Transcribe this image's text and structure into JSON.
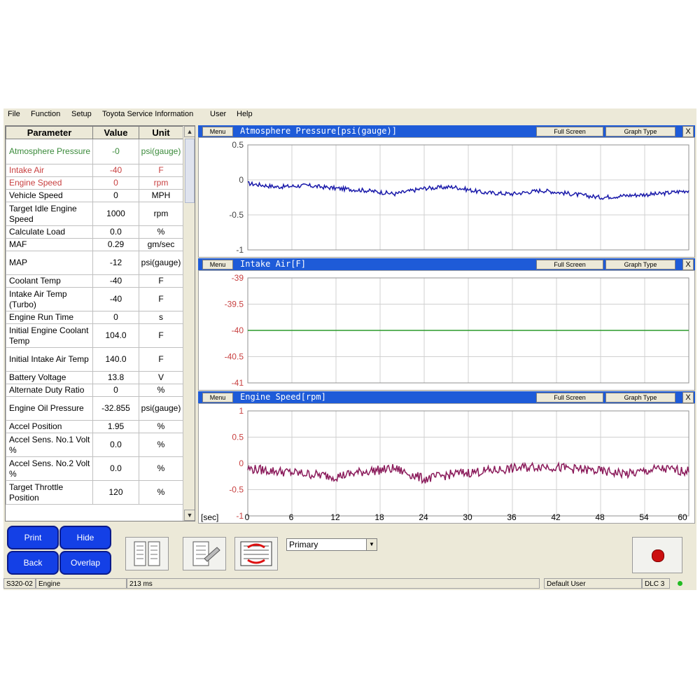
{
  "menu": [
    "File",
    "Function",
    "Setup",
    "Toyota Service Information",
    "User",
    "Help"
  ],
  "table": {
    "headers": [
      "Parameter",
      "Value",
      "Unit"
    ],
    "rows": [
      {
        "p": "Atmosphere Pressure",
        "v": "-0",
        "u": "psi(gauge)",
        "color": "#3a8a3a"
      },
      {
        "p": "Intake Air",
        "v": "-40",
        "u": "F",
        "color": "#c84040"
      },
      {
        "p": "Engine Speed",
        "v": "0",
        "u": "rpm",
        "color": "#c84040"
      },
      {
        "p": "Vehicle Speed",
        "v": "0",
        "u": "MPH",
        "color": "#000000"
      },
      {
        "p": "Target Idle Engine Speed",
        "v": "1000",
        "u": "rpm",
        "color": "#000000"
      },
      {
        "p": "Calculate Load",
        "v": "0.0",
        "u": "%",
        "color": "#000000"
      },
      {
        "p": "MAF",
        "v": "0.29",
        "u": "gm/sec",
        "color": "#000000"
      },
      {
        "p": "MAP",
        "v": "-12",
        "u": "psi(gauge)",
        "color": "#000000"
      },
      {
        "p": "Coolant Temp",
        "v": "-40",
        "u": "F",
        "color": "#000000"
      },
      {
        "p": "Intake Air Temp (Turbo)",
        "v": "-40",
        "u": "F",
        "color": "#000000"
      },
      {
        "p": "Engine Run Time",
        "v": "0",
        "u": "s",
        "color": "#000000"
      },
      {
        "p": "Initial Engine Coolant Temp",
        "v": "104.0",
        "u": "F",
        "color": "#000000"
      },
      {
        "p": "Initial Intake Air Temp",
        "v": "140.0",
        "u": "F",
        "color": "#000000"
      },
      {
        "p": "Battery Voltage",
        "v": "13.8",
        "u": "V",
        "color": "#000000"
      },
      {
        "p": "Alternate Duty Ratio",
        "v": "0",
        "u": "%",
        "color": "#000000"
      },
      {
        "p": "Engine Oil Pressure",
        "v": "-32.855",
        "u": "psi(gauge)",
        "color": "#000000"
      },
      {
        "p": "Accel Position",
        "v": "1.95",
        "u": "%",
        "color": "#000000"
      },
      {
        "p": "Accel Sens. No.1 Volt %",
        "v": "0.0",
        "u": "%",
        "color": "#000000"
      },
      {
        "p": "Accel Sens. No.2 Volt %",
        "v": "0.0",
        "u": "%",
        "color": "#000000"
      },
      {
        "p": "Target Throttle Position",
        "v": "120",
        "u": "%",
        "color": "#000000"
      }
    ]
  },
  "graph_ui": {
    "menu_label": "Menu",
    "fullscreen_label": "Full Screen",
    "graphtype_label": "Graph Type",
    "close_label": "X"
  },
  "x_axis": {
    "unit_label": "[sec]",
    "ticks": [
      "0",
      "6",
      "12",
      "18",
      "24",
      "30",
      "36",
      "42",
      "48",
      "54",
      "60"
    ]
  },
  "chart_data": [
    {
      "type": "line",
      "title": "Atmosphere Pressure[psi(gauge)]",
      "series": [
        {
          "color": "#1a1aaa",
          "values": [
            -0.05,
            -0.1,
            -0.08,
            -0.12,
            -0.15,
            -0.2,
            -0.12,
            -0.1,
            -0.18,
            -0.2,
            -0.15,
            -0.2,
            -0.25,
            -0.22,
            -0.2,
            -0.15
          ]
        }
      ],
      "ylim": [
        -1,
        0.5
      ],
      "yticks": [
        "0.5",
        "0",
        "-0.5",
        "-1"
      ],
      "tick_color": "#444444",
      "x": [
        0,
        60
      ]
    },
    {
      "type": "line",
      "title": "Intake Air[F]",
      "series": [
        {
          "color": "#2a9a2a",
          "values": [
            -40,
            -40
          ]
        }
      ],
      "ylim": [
        -41,
        -39
      ],
      "yticks": [
        "-39",
        "-39.5",
        "-40",
        "-40.5",
        "-41"
      ],
      "tick_color": "#c84040",
      "x": [
        0,
        60
      ]
    },
    {
      "type": "line",
      "title": "Engine Speed[rpm]",
      "series": [
        {
          "color": "#8a1a5a",
          "values": [
            -0.1,
            -0.15,
            -0.2,
            -0.25,
            -0.15,
            -0.1,
            -0.3,
            -0.2,
            -0.15,
            -0.1,
            -0.05,
            -0.1,
            -0.15,
            -0.2,
            -0.1,
            -0.15
          ]
        }
      ],
      "ylim": [
        -1,
        1
      ],
      "yticks": [
        "1",
        "0.5",
        "0",
        "-0.5",
        "-1"
      ],
      "tick_color": "#c84040",
      "x": [
        0,
        60
      ]
    }
  ],
  "buttons": {
    "print": "Print",
    "hide": "Hide",
    "back": "Back",
    "overlap": "Overlap"
  },
  "select": {
    "value": "Primary"
  },
  "status": {
    "code": "S320-02",
    "system": "Engine",
    "interval": "213 ms",
    "user": "Default User",
    "dlc": "DLC 3"
  }
}
